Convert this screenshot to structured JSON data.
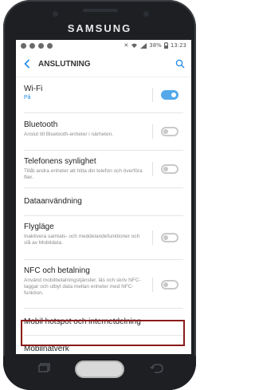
{
  "device": {
    "brand": "SAMSUNG"
  },
  "status_bar": {
    "battery_percent": "38%",
    "time": "13:23"
  },
  "header": {
    "title": "ANSLUTNING"
  },
  "settings": [
    {
      "title": "Wi-Fi",
      "status": "På",
      "toggle": "on"
    },
    {
      "title": "Bluetooth",
      "subtitle": "Anslut till Bluetooth-enheter i närheten.",
      "toggle": "off"
    },
    {
      "title": "Telefonens synlighet",
      "subtitle": "Tillåt andra enheter att hitta din telefon och överföra filer.",
      "toggle": "off"
    },
    {
      "title": "Dataanvändning"
    },
    {
      "title": "Flygläge",
      "subtitle": "Inaktivera samtals- och meddelandefunktioner och slå av Mobildata.",
      "toggle": "off"
    },
    {
      "title": "NFC och betalning",
      "subtitle": "Använd mobilbetalningstjänster, läs och skriv NFC-taggar och utbyt data mellan enheter med NFC-funktion.",
      "toggle": "off"
    },
    {
      "title": "Mobil hotspot och internetdelning"
    },
    {
      "title": "Mobilnätverk"
    }
  ],
  "colors": {
    "accent": "#1e88e5",
    "highlight_border": "#8b1a1a",
    "toggle_on": "#53a9ea",
    "phone_body": "#1d1f23"
  },
  "icons": {
    "back": "chevron-left-icon",
    "search": "search-icon",
    "wifi": "wifi-icon",
    "signal": "signal-icon",
    "battery": "battery-icon"
  }
}
